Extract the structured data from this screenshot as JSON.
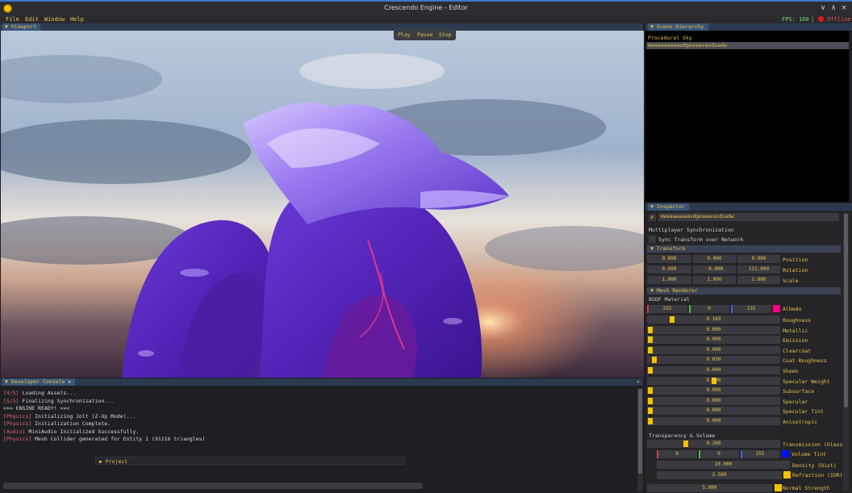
{
  "window": {
    "title": "Crescendo Engine - Editor",
    "controls": [
      "∨",
      "∧",
      "×"
    ]
  },
  "menu": {
    "items": [
      "File",
      "Edit",
      "Window",
      "Help"
    ],
    "fps": "FPS: 100",
    "separator": "|",
    "network_status": "Offline"
  },
  "viewport": {
    "tab": "Viewport",
    "play": "Play",
    "pause": "Pause",
    "stop": "Stop"
  },
  "hierarchy": {
    "tab": "Scene Hierarchy",
    "items": [
      "Procedural Sky",
      "mwaaaaaaaavdgeswavasdsadw"
    ]
  },
  "inspector": {
    "tab": "Inspector",
    "entity_name": "mwaaaaaaaavdgeswavasdsadw",
    "multiplayer_label": "Multiplayer Synchronization",
    "sync_label": "Sync Transform over Network",
    "transform": {
      "header": "Transform",
      "position": {
        "label": "Position",
        "x": "0.000",
        "y": "0.000",
        "z": "0.000"
      },
      "rotation": {
        "label": "Rotation",
        "x": "0.000",
        "y": "-0.000",
        "z": "121.000"
      },
      "scale": {
        "label": "Scale",
        "x": "1.000",
        "y": "1.000",
        "z": "1.000"
      }
    },
    "mesh_renderer": {
      "header": "Mesh Renderer",
      "material_label": "BSDF Material",
      "albedo": {
        "label": "Albedo",
        "r": "255",
        "g": "0",
        "b": "135",
        "color": "#ff0087"
      },
      "sliders": [
        {
          "label": "Roughness",
          "value": "0.169",
          "fraction": 0.169
        },
        {
          "label": "Metallic",
          "value": "0.000",
          "fraction": 0.0
        },
        {
          "label": "Emission",
          "value": "0.000",
          "fraction": 0.0
        },
        {
          "label": "Clearcoat",
          "value": "0.000",
          "fraction": 0.0
        },
        {
          "label": "Coat Roughness",
          "value": "0.030",
          "fraction": 0.03
        },
        {
          "label": "Sheen",
          "value": "0.000",
          "fraction": 0.0
        },
        {
          "label": "Specular Weight",
          "value": "0.500",
          "fraction": 0.5
        },
        {
          "label": "Subsurface",
          "value": "0.000",
          "fraction": 0.0
        },
        {
          "label": "Specular",
          "value": "0.000",
          "fraction": 0.0
        },
        {
          "label": "Specular Tint",
          "value": "0.000",
          "fraction": 0.0
        },
        {
          "label": "Anisotropic",
          "value": "0.000",
          "fraction": 0.0
        }
      ]
    },
    "transparency": {
      "label": "Transparency & Volume",
      "transmission": {
        "label": "Transmission (Glass)",
        "value": "0.260",
        "fraction": 0.26
      },
      "volume_tint": {
        "label": "Volume Tint",
        "r": "0",
        "g": "0",
        "b": "255",
        "color": "#0010ff"
      },
      "density": {
        "label": "Density (Dist)",
        "value": "10.000"
      },
      "refraction": {
        "label": "Refraction (IOR)",
        "value": "2.500"
      },
      "normal_strength": {
        "label": "Normal Strength",
        "value": "5.000"
      }
    }
  },
  "console": {
    "tab": "Developer Console",
    "close": "×",
    "panel_close": "×",
    "lines": [
      {
        "tag": "[4/5]",
        "text": " Loading Assets..."
      },
      {
        "tag": "[5/5]",
        "text": " Finalizing Synchronization..."
      },
      {
        "tag": "",
        "text": ">>> ENGINE READY! <<<"
      },
      {
        "tag": "[Physics]",
        "text": " Initializing Jolt (Z-Up Mode)..."
      },
      {
        "tag": "[Physics]",
        "text": " Initialization Complete."
      },
      {
        "tag": "[Audio]",
        "text": " MiniAudio Initialized Successfully."
      },
      {
        "tag": "[Physics]",
        "text": " Mesh Collider generated for Entity 1 (91216 triangles)"
      }
    ],
    "project_label": "▶ Project"
  },
  "colors": {
    "accent": "#e8c24a",
    "slider_grab": "#f4c300",
    "panel_header": "#2c3a4f",
    "status_red": "#e01818",
    "fps_green": "#6fe06f"
  }
}
